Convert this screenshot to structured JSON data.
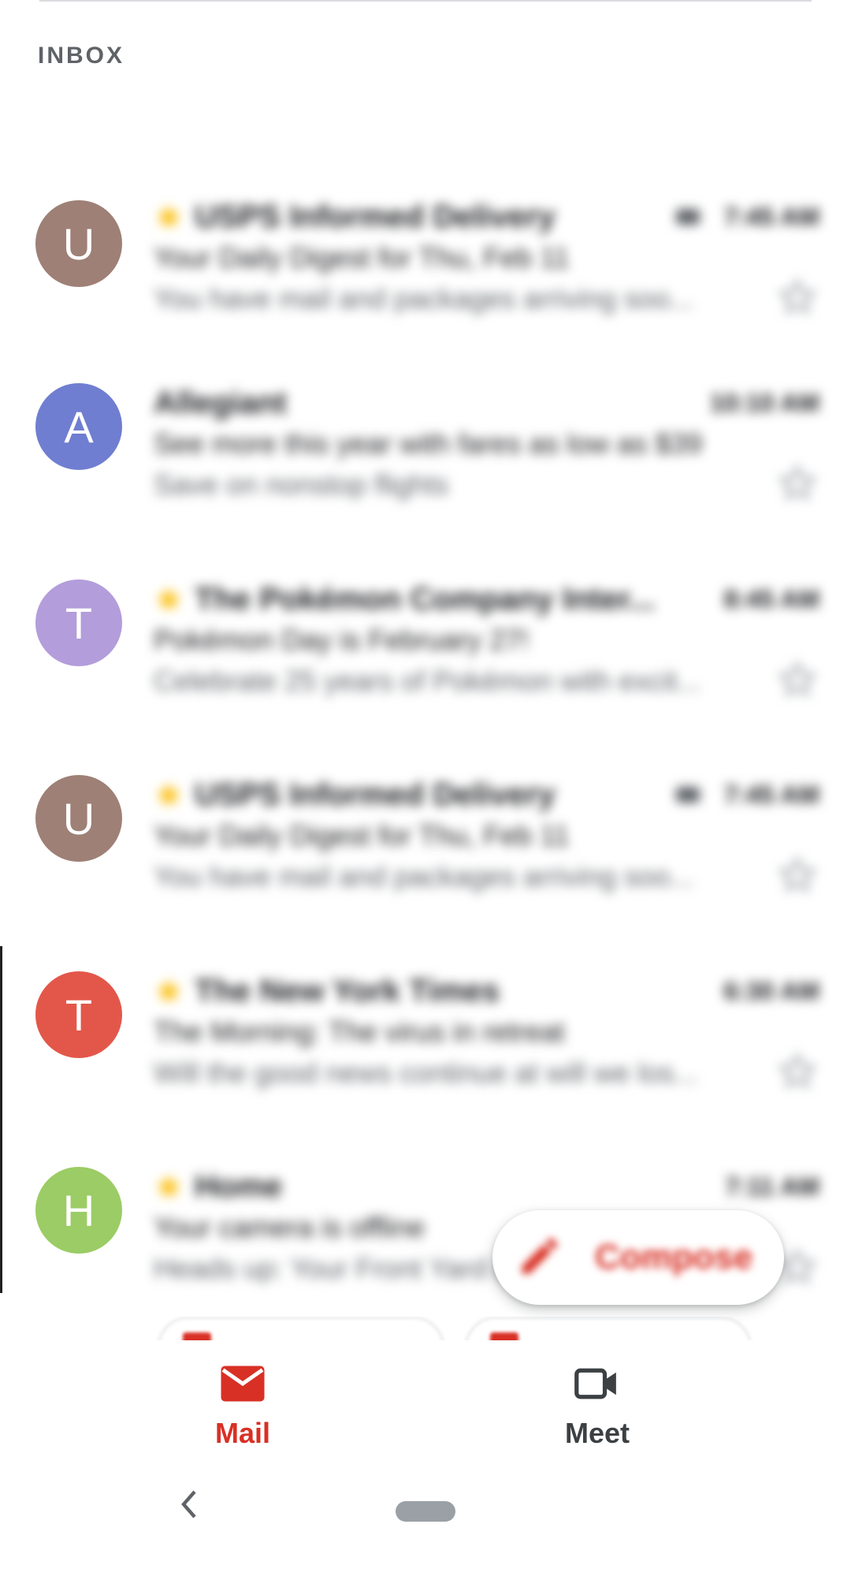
{
  "section": {
    "label": "INBOX"
  },
  "emails": [
    {
      "avatar_letter": "U",
      "avatar_color": "#9e8076",
      "important": true,
      "attachment": true,
      "sender": "USPS Informed Delivery",
      "time": "7:45 AM",
      "subject": "Your Daily Digest for Thu, Feb 11",
      "snippet": "You have mail and packages arriving soo..."
    },
    {
      "avatar_letter": "A",
      "avatar_color": "#6f7ed0",
      "important": false,
      "attachment": false,
      "sender": "Allegiant",
      "time": "10:10 AM",
      "subject": "See more this year with fares as low as $39",
      "snippet": "Save on nonstop flights"
    },
    {
      "avatar_letter": "T",
      "avatar_color": "#b39ddb",
      "important": true,
      "attachment": false,
      "sender": "The Pokémon Company Inter...",
      "time": "8:45 AM",
      "subject": "Pokémon Day is February 27!",
      "snippet": "Celebrate 25 years of Pokémon with excit..."
    },
    {
      "avatar_letter": "U",
      "avatar_color": "#9e8076",
      "important": true,
      "attachment": true,
      "sender": "USPS Informed Delivery",
      "time": "7:45 AM",
      "subject": "Your Daily Digest for Thu, Feb 11",
      "snippet": "You have mail and packages arriving soo..."
    },
    {
      "avatar_letter": "T",
      "avatar_color": "#e3574a",
      "important": true,
      "attachment": false,
      "sender": "The New York Times",
      "time": "6:30 AM",
      "subject": "The Morning: The virus in retreat",
      "snippet": "Will the good news continue at will we los..."
    },
    {
      "avatar_letter": "H",
      "avatar_color": "#9ccc65",
      "important": true,
      "attachment": false,
      "sender": "Home",
      "time": "7:11 AM",
      "subject": "Your camera is offline",
      "snippet": "Heads up: Your Front Yard camera..."
    }
  ],
  "compose": {
    "label": "Compose",
    "icon": "pencil-icon"
  },
  "bottom_nav": {
    "mail": {
      "label": "Mail",
      "icon": "mail-icon",
      "color": "#d93025"
    },
    "meet": {
      "label": "Meet",
      "icon": "video-camera-icon",
      "color": "#3c4043"
    }
  },
  "system_nav": {
    "back_icon": "back-chevron-icon",
    "home_icon": "home-pill-icon"
  }
}
